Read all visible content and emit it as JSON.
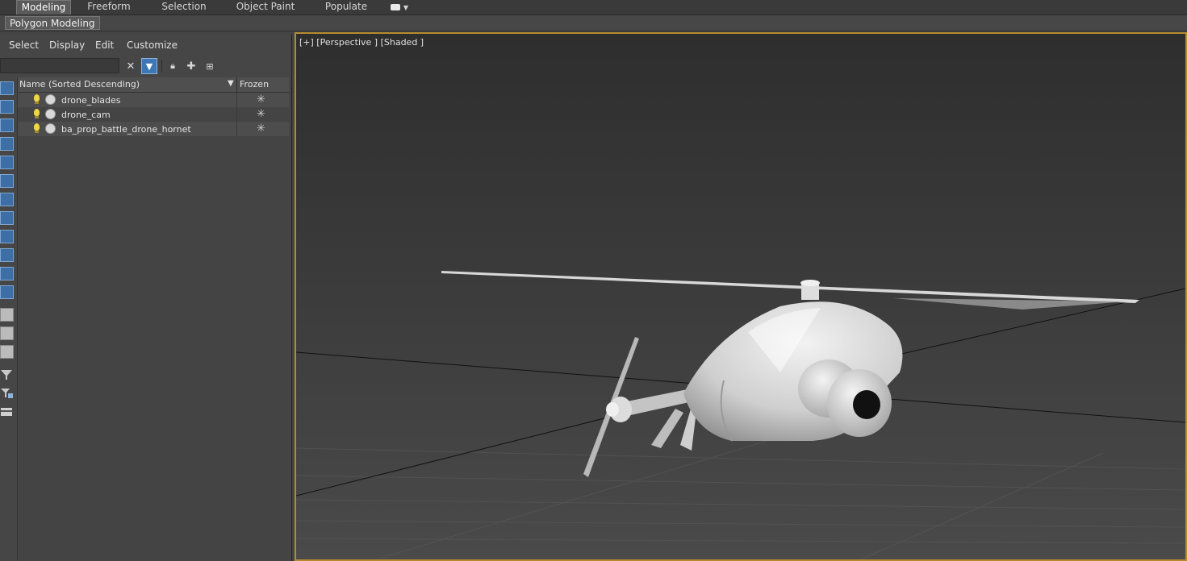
{
  "ribbon": {
    "tabs": [
      "Modeling",
      "Freeform",
      "Selection",
      "Object Paint",
      "Populate"
    ],
    "active_tab": "Modeling",
    "sub_tab": "Polygon Modeling"
  },
  "explorer": {
    "menu": [
      "Select",
      "Display",
      "Edit",
      "Customize"
    ],
    "search_value": "",
    "columns": {
      "name": "Name (Sorted Descending)",
      "frozen": "Frozen"
    },
    "rows": [
      {
        "name": "drone_blades"
      },
      {
        "name": "drone_cam"
      },
      {
        "name": "ba_prop_battle_drone_hornet"
      }
    ]
  },
  "viewport": {
    "label": "[+] [Perspective ] [Shaded ]",
    "border_color": "#b58b2e"
  }
}
